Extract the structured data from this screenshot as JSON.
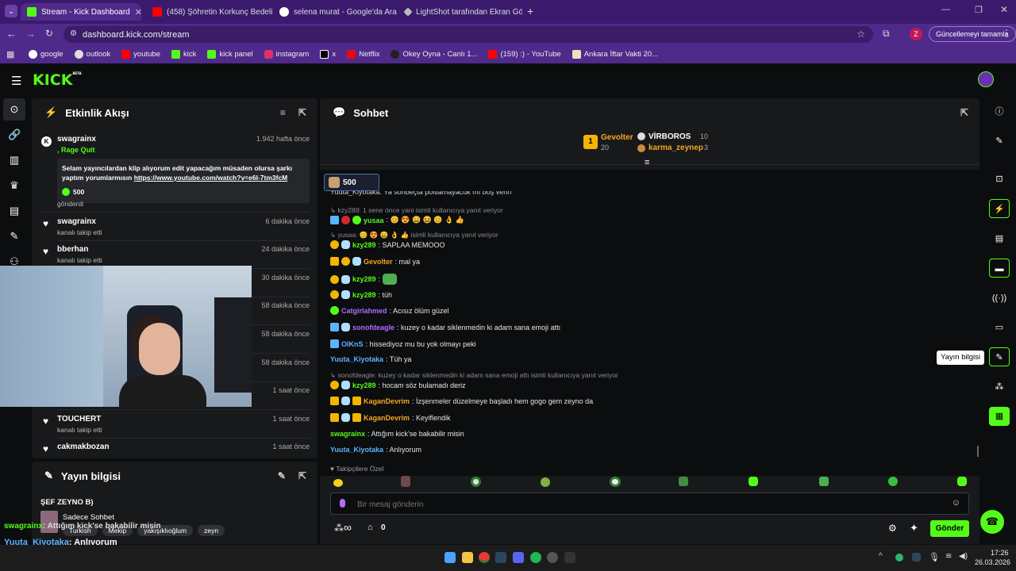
{
  "browser": {
    "tabs": [
      {
        "title": "Stream - Kick Dashboard",
        "active": true,
        "favicon_color": "#53fc18"
      },
      {
        "title": "(458) Şöhretin Korkunç Bedeli:",
        "active": false,
        "favicon_color": "#ff0000"
      },
      {
        "title": "selena murat - Google'da Ara",
        "active": false,
        "favicon_color": "#ffffff"
      },
      {
        "title": "LightShot tarafından Ekran Gör",
        "active": false,
        "favicon_color": "#cccccc"
      }
    ],
    "url": "dashboard.kick.com/stream",
    "profile_letter": "Z",
    "update_label": "Güncellemeyi tamamla",
    "bookmarks": [
      "google",
      "outlook",
      "youtube",
      "kick",
      "kick panel",
      "instagram",
      "x",
      "Netflix",
      "Okey Oyna - Canlı 1...",
      "(159) :) - YouTube",
      "Ankara İftar Vakti 20..."
    ]
  },
  "kick": {
    "logo": "KICK",
    "beta": "BETA"
  },
  "activity": {
    "title": "Etkinlik Akışı",
    "featured": {
      "user": "swagrainx",
      "time": "1.942 hafta önce",
      "tag": ", Rage Quit",
      "message": "Selam yayıncılardan klip alıyorum edit yapacağım müsaden olursa şarkı yaptım yorumlarmısın ",
      "link": "https://www.youtube.com/watch?v=e6I-7tm3fcM",
      "amount": "500",
      "sent": "gönderdi"
    },
    "items": [
      {
        "user": "swagrainx",
        "action": "kanalı takip etti",
        "time": "6 dakika önce"
      },
      {
        "user": "bberhan",
        "action": "kanalı takip etti",
        "time": "24 dakika önce"
      },
      {
        "user": "",
        "action": "",
        "time": "30 dakika önce"
      },
      {
        "user": "",
        "action": "",
        "time": "58 dakika önce"
      },
      {
        "user": "",
        "action": "",
        "time": "58 dakika önce"
      },
      {
        "user": "",
        "action": "",
        "time": "58 dakika önce"
      },
      {
        "user": "",
        "action": "",
        "time": "1 saat önce"
      },
      {
        "user": "TOUCHERT",
        "action": "kanalı takip etti",
        "time": "1 saat önce"
      },
      {
        "user": "cakmakbozan",
        "action": "",
        "time": "1 saat önce"
      }
    ]
  },
  "stream_info": {
    "title": "Yayın bilgisi",
    "stream_title": "ŞEF ZEYNO B)",
    "category": "Sadece Sohbet",
    "tags": [
      "Turkish",
      "Mekip",
      "yakışıklıoğlum",
      "zeyn"
    ]
  },
  "overlay_chat": [
    {
      "user": "swagrainx",
      "text": ": Attığım kick'se bakabilir misin"
    },
    {
      "user": "Yuuta_Kiyotaka",
      "text": ": Anlıyorum"
    }
  ],
  "chat": {
    "title": "Sohbet",
    "leaderboard": [
      {
        "user": "Gevolter",
        "value": "20"
      },
      {
        "user": "VİRBOROS",
        "value": "10"
      },
      {
        "user": "karma_zeynep",
        "value": "3"
      }
    ],
    "pinned_amount": "500",
    "cut_message": "Yuuta_Kiyotaka: Ya sohbeçta poltlamayacuk mı boş verin",
    "messages": [
      {
        "type": "reply",
        "text": "kzy289: 1 sene önce yani isimli kullanıcıya yanıt veriyor"
      },
      {
        "type": "msg",
        "user": "yusaa",
        "color": "#53fc18",
        "text": ": 😊 😍 😄 😆 😊 👌 👍",
        "badges": [
          "blue",
          "red",
          "grn"
        ]
      },
      {
        "type": "reply",
        "text": "yusaa: 😊 😍 😄 👌 👍 isimli kullanıcıya yanıt veriyor"
      },
      {
        "type": "msg",
        "user": "kzy289",
        "color": "#53fc18",
        "text": ": SAPLAA MEMOOO",
        "badges": [
          "gold",
          "sky"
        ]
      },
      {
        "type": "msg",
        "user": "Gevolter",
        "color": "#f5a623",
        "text": ": mal ya",
        "badges": [
          "crown",
          "gold",
          "sky"
        ]
      },
      {
        "type": "msg",
        "user": "kzy289",
        "color": "#53fc18",
        "text": ":",
        "badges": [
          "gold",
          "sky"
        ]
      },
      {
        "type": "msg",
        "user": "kzy289",
        "color": "#53fc18",
        "text": ": tüh",
        "badges": [
          "gold",
          "sky"
        ]
      },
      {
        "type": "msg",
        "user": "Catgirlahmed",
        "color": "#b36bff",
        "text": ": Acısız ölüm güzel",
        "badges": [
          "grn"
        ]
      },
      {
        "type": "msg",
        "user": "sonofdeagle",
        "color": "#b36bff",
        "text": ": kuzey o kadar siklenmedin ki adam sana emoji attı",
        "badges": [
          "blue",
          "sky"
        ]
      },
      {
        "type": "msg",
        "user": "OlKnS",
        "color": "#5cb3ff",
        "text": ": hissediyoz mu bu yok olmayı peki",
        "badges": [
          "blue"
        ]
      },
      {
        "type": "msg",
        "user": "Yuuta_Kiyotaka",
        "color": "#5cb3ff",
        "text": ": Tüh ya",
        "badges": []
      },
      {
        "type": "reply",
        "text": "sonofdeagle: kuzey o kadar siklenmedin ki adam sana emoji attı isimli kullanıcıya yanıt veriyor"
      },
      {
        "type": "msg",
        "user": "kzy289",
        "color": "#53fc18",
        "text": ": hocam söz bulamadı deriz",
        "badges": [
          "gold",
          "sky"
        ]
      },
      {
        "type": "msg",
        "user": "KaganDevrim",
        "color": "#f5a623",
        "text": ": İzşenmeler düzelmeye başladı hem gogo gem zeyno da",
        "badges": [
          "crown",
          "sky",
          "crown"
        ]
      },
      {
        "type": "msg",
        "user": "KaganDevrim",
        "color": "#f5a623",
        "text": ": Keyiflendik",
        "badges": [
          "crown",
          "sky",
          "crown"
        ]
      },
      {
        "type": "msg",
        "user": "swagrainx",
        "color": "#53fc18",
        "text": ": Attığım kick'se bakabilir misin",
        "badges": []
      },
      {
        "type": "msg",
        "user": "Yuuta_Kiyotaka",
        "color": "#5cb3ff",
        "text": ": Anlıyorum",
        "badges": []
      }
    ],
    "followers_special": "Takipçilere Özel",
    "input_placeholder": "Bir mesaj gönderin",
    "infinity": "∞",
    "points": "0",
    "send_label": "Gönder"
  },
  "right_rail": {
    "tooltip": "Yayın bilgisi"
  },
  "taskbar": {
    "time": "17:26",
    "date": "26.03.2026"
  },
  "colors": {
    "kick_green": "#53fc18",
    "browser_purple": "#4f2a8a",
    "panel": "#18191b"
  }
}
